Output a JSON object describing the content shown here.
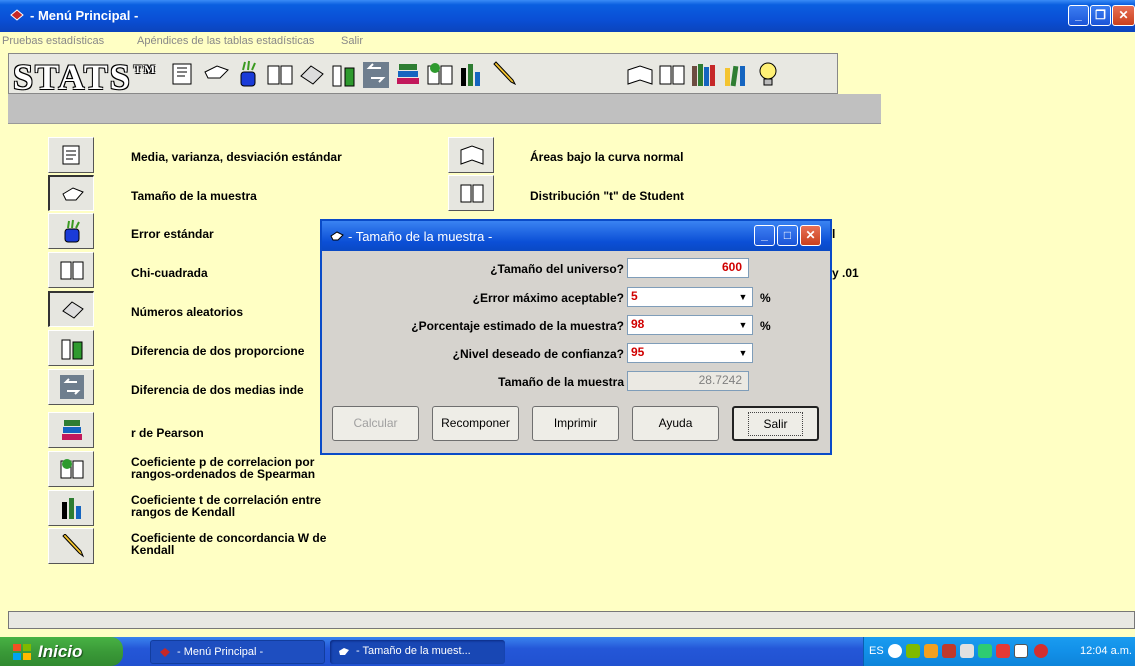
{
  "window": {
    "title": "- Menú Principal -"
  },
  "menu": [
    "Pruebas estadísticas",
    "Apéndices de las tablas estadísticas",
    "Salir"
  ],
  "toolbar": {
    "logo": "STATS",
    "tm": "TM"
  },
  "left_items": [
    "Media, varianza, desviación estándar",
    "Tamaño de la muestra",
    "Error estándar",
    "Chi-cuadrada",
    "Números aleatorios",
    "Diferencia de dos proporcione",
    "Diferencia de dos medias inde",
    "r de Pearson",
    "Coeficiente p de correlacion por rangos-ordenados de Spearman",
    "Coeficiente t de correlación entre rangos de Kendall",
    "Coeficiente de concordancia W de Kendall"
  ],
  "right_items": [
    "Áreas bajo la curva normal",
    "Distribución \"t\" de Student"
  ],
  "partial_text": {
    "r3": "l",
    "r4": "y .01"
  },
  "dialog": {
    "title": "- Tamaño de la muestra -",
    "universo_label": "¿Tamaño del universo?",
    "universo_value": "600",
    "error_label": "¿Error máximo aceptable?",
    "error_value": "5",
    "porcentaje_label": "¿Porcentaje estimado de la muestra?",
    "porcentaje_value": "98",
    "confianza_label": "¿Nivel deseado de confianza?",
    "confianza_value": "95",
    "resultado_label": "Tamaño de la muestra",
    "resultado_value": "28.7242",
    "pct_symbol": "%",
    "buttons": {
      "calcular": "Calcular",
      "recomponer": "Recomponer",
      "imprimir": "Imprimir",
      "ayuda": "Ayuda",
      "salir": "Salir"
    }
  },
  "taskbar": {
    "start": "Inicio",
    "tasks": [
      "- Menú Principal -",
      "- Tamaño de la muest..."
    ],
    "lang": "ES",
    "clock": "12:04 a.m."
  },
  "colors": {
    "background": "#FFFFC4",
    "titlebar": "#0A4FD6",
    "field_text": "#D00000"
  }
}
